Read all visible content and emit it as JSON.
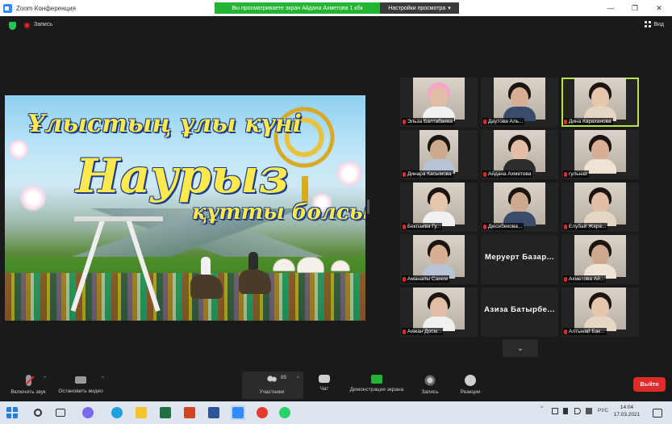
{
  "window": {
    "title": "Zoom Конференция",
    "share_banner": "Вы просматриваете экран Айдана Ахметова 1 кбк",
    "view_options": "Настройки просмотра",
    "view_options_caret": "▾",
    "minimize": "—",
    "maximize": "❐",
    "close": "✕"
  },
  "topbar": {
    "recording_label": "Запись",
    "view_label": "Вид"
  },
  "shared_screen": {
    "line1": "Ұлыстың ұлы күні",
    "line2": "Наурыз",
    "line3": "құтты болсын!"
  },
  "gallery": {
    "tiles": [
      {
        "name": "Эльза Балтабаева",
        "style": "hijab"
      },
      {
        "name": "Даутова Аль...",
        "style": "girl"
      },
      {
        "name": "Дина Караханова",
        "style": "girl",
        "speaking": true
      },
      {
        "name": "Динара Касымова",
        "style": "small"
      },
      {
        "name": "Айдана Ахметова",
        "style": "girl"
      },
      {
        "name": "гульназ",
        "style": "girl"
      },
      {
        "name": "Бекпаева Гу...",
        "style": "girl"
      },
      {
        "name": "Дюсебекова...",
        "style": "girl"
      },
      {
        "name": "Елубай Жара...",
        "style": "girl"
      },
      {
        "name": "Аманалы Санем",
        "style": "girl"
      },
      {
        "name": "",
        "big_name": "Меруерт Базар...",
        "style": "none"
      },
      {
        "name": "Ахметова Ай...",
        "style": "girl"
      },
      {
        "name": "Аяжан Досм...",
        "style": "girl"
      },
      {
        "name": "",
        "big_name": "Азиза Батырбе...",
        "style": "none"
      },
      {
        "name": "Алтынай Бак...",
        "style": "girl"
      }
    ],
    "next_page": "⌄"
  },
  "toolbar": {
    "mute_label": "Включить звук",
    "video_label": "Остановить видео",
    "participants_label": "Участники",
    "participants_count": "85",
    "chat_label": "Чат",
    "share_label": "Демонстрация экрана",
    "record_label": "Запись",
    "reactions_label": "Реакции",
    "leave_label": "Выйти",
    "caret": "^"
  },
  "taskbar": {
    "lang": "РУС",
    "time": "14:04",
    "date": "17.03.2021",
    "tray_arrow": "^"
  },
  "colors": {
    "accent_green": "#23b432",
    "leave_red": "#e02b2b",
    "speaking_outline": "#b8e34a",
    "zoom_blue": "#2d8cff"
  }
}
